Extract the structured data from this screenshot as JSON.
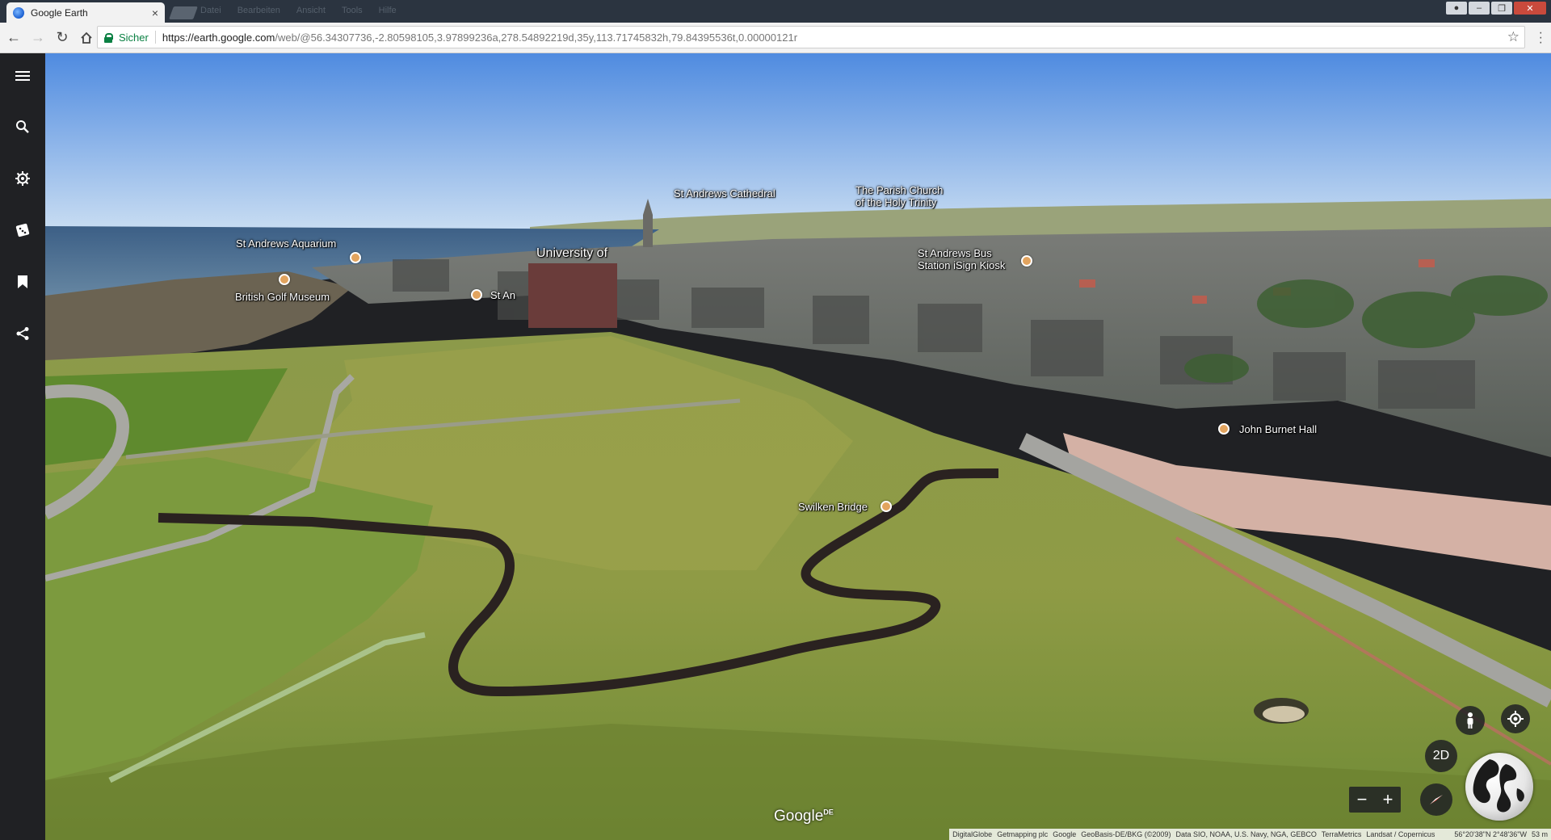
{
  "browser": {
    "tab_title": "Google Earth",
    "tab_close": "×",
    "ghost_menu": [
      "Datei",
      "Bearbeiten",
      "Ansicht",
      "Tools",
      "Hilfe"
    ],
    "secure_label": "Sicher",
    "url_host": "https://earth.google.com",
    "url_path": "/web/@56.34307736,-2.80598105,3.97899236a,278.54892219d,35y,113.71745832h,79.84395536t,0.00000121r"
  },
  "map": {
    "labels": {
      "aquarium": "St Andrews Aquarium",
      "golf_museum": "British Golf Museum",
      "cathedral": "St Andrews Cathedral",
      "parish_church_line1": "The Parish Church",
      "parish_church_line2": "of the Holy Trinity",
      "university": "University of",
      "st_an": "St An",
      "bus_station_line1": "St Andrews Bus",
      "bus_station_line2": "Station iSign Kiosk",
      "john_burnet": "John Burnet Hall",
      "swilken": "Swilken Bridge"
    },
    "google_logo": "Google",
    "google_logo_sup": "DE",
    "controls": {
      "view_mode": "2D",
      "zoom_out": "−",
      "zoom_in": "+"
    },
    "attribution": [
      "DigitalGlobe",
      "Getmapping plc",
      "Google",
      "GeoBasis-DE/BKG (©2009)",
      "Data SIO, NOAA, U.S. Navy, NGA, GEBCO",
      "TerraMetrics",
      "Landsat / Copernicus",
      "56°20'38\"N 2°48'36\"W",
      "53 m"
    ]
  }
}
